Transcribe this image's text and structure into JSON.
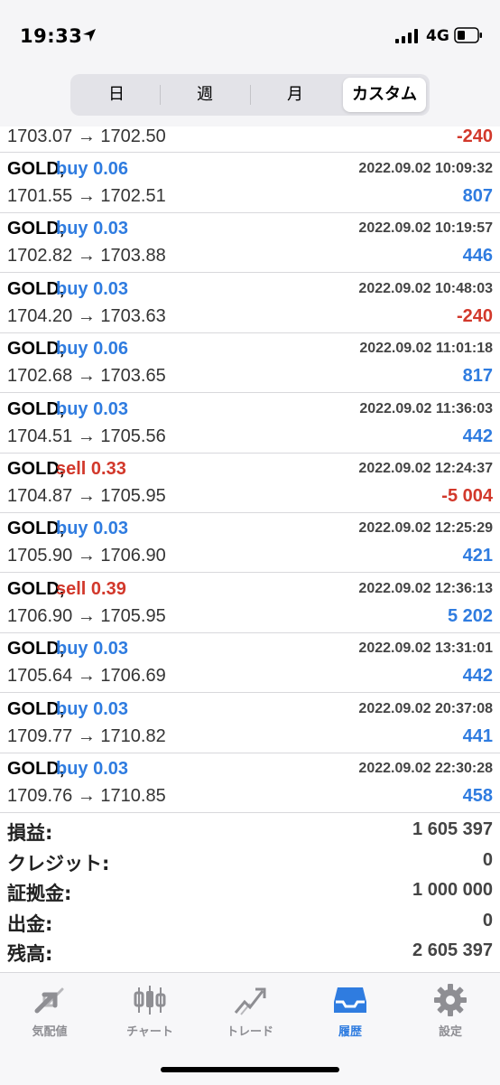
{
  "status_bar": {
    "time": "19:33",
    "network": "4G"
  },
  "segments": [
    {
      "label": "日"
    },
    {
      "label": "週"
    },
    {
      "label": "月"
    },
    {
      "label": "カスタム",
      "active": true
    }
  ],
  "first_row": {
    "price": "1703.07 → 1702.50",
    "profit": "-240"
  },
  "trades": [
    {
      "symbol": "GOLD,",
      "side": "buy 0.06",
      "date": "2022.09.02 10:09:32",
      "price": "1701.55 → 1702.51",
      "profit": "807",
      "side_color": "blue",
      "profit_color": "blue"
    },
    {
      "symbol": "GOLD,",
      "side": "buy 0.03",
      "date": "2022.09.02 10:19:57",
      "price": "1702.82 → 1703.88",
      "profit": "446",
      "side_color": "blue",
      "profit_color": "blue"
    },
    {
      "symbol": "GOLD,",
      "side": "buy 0.03",
      "date": "2022.09.02 10:48:03",
      "price": "1704.20 → 1703.63",
      "profit": "-240",
      "side_color": "blue",
      "profit_color": "red"
    },
    {
      "symbol": "GOLD,",
      "side": "buy 0.06",
      "date": "2022.09.02 11:01:18",
      "price": "1702.68 → 1703.65",
      "profit": "817",
      "side_color": "blue",
      "profit_color": "blue"
    },
    {
      "symbol": "GOLD,",
      "side": "buy 0.03",
      "date": "2022.09.02 11:36:03",
      "price": "1704.51 → 1705.56",
      "profit": "442",
      "side_color": "blue",
      "profit_color": "blue"
    },
    {
      "symbol": "GOLD,",
      "side": "sell 0.33",
      "date": "2022.09.02 12:24:37",
      "price": "1704.87 → 1705.95",
      "profit": "-5 004",
      "side_color": "red",
      "profit_color": "red"
    },
    {
      "symbol": "GOLD,",
      "side": "buy 0.03",
      "date": "2022.09.02 12:25:29",
      "price": "1705.90 → 1706.90",
      "profit": "421",
      "side_color": "blue",
      "profit_color": "blue"
    },
    {
      "symbol": "GOLD,",
      "side": "sell 0.39",
      "date": "2022.09.02 12:36:13",
      "price": "1706.90 → 1705.95",
      "profit": "5 202",
      "side_color": "red",
      "profit_color": "blue"
    },
    {
      "symbol": "GOLD,",
      "side": "buy 0.03",
      "date": "2022.09.02 13:31:01",
      "price": "1705.64 → 1706.69",
      "profit": "442",
      "side_color": "blue",
      "profit_color": "blue"
    },
    {
      "symbol": "GOLD,",
      "side": "buy 0.03",
      "date": "2022.09.02 20:37:08",
      "price": "1709.77 → 1710.82",
      "profit": "441",
      "side_color": "blue",
      "profit_color": "blue"
    },
    {
      "symbol": "GOLD,",
      "side": "buy 0.03",
      "date": "2022.09.02 22:30:28",
      "price": "1709.76 → 1710.85",
      "profit": "458",
      "side_color": "blue",
      "profit_color": "blue"
    }
  ],
  "summary": [
    {
      "label": "損益:",
      "value": "1 605 397"
    },
    {
      "label": "クレジット:",
      "value": "0"
    },
    {
      "label": "証拠金:",
      "value": "1 000 000"
    },
    {
      "label": "出金:",
      "value": "0"
    },
    {
      "label": "残高:",
      "value": "2 605 397"
    }
  ],
  "tabs": [
    {
      "label": "気配値",
      "icon": "quotes-icon"
    },
    {
      "label": "チャート",
      "icon": "chart-icon"
    },
    {
      "label": "トレード",
      "icon": "trade-icon"
    },
    {
      "label": "履歴",
      "icon": "history-icon",
      "active": true
    },
    {
      "label": "設定",
      "icon": "settings-icon"
    }
  ],
  "colors": {
    "blue": "#2f7ce0",
    "red": "#d2382b"
  }
}
